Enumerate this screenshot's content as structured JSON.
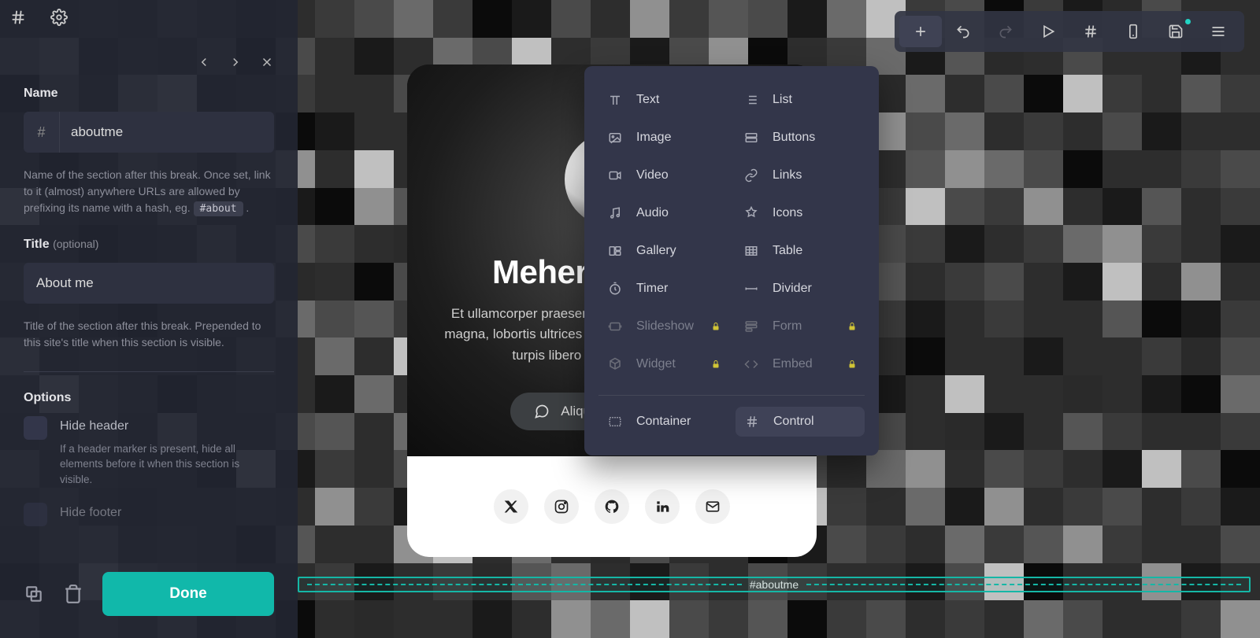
{
  "sidebar": {
    "name_label": "Name",
    "name_value": "aboutme",
    "name_help_pre": "Name of the section after this break. Once set, link to it (almost) anywhere URLs are allowed by prefixing its name with a hash, eg. ",
    "name_help_code": "#about",
    "title_label": "Title",
    "title_suffix": "(optional)",
    "title_value": "About me",
    "title_help": "Title of the section after this break. Prepended to this site's title when this section is visible.",
    "options_label": "Options",
    "opt_hide_header": "Hide header",
    "opt_hide_header_help": "If a header marker is present, hide all elements before it when this section is visible.",
    "opt_hide_footer": "Hide footer",
    "done": "Done"
  },
  "toolbar": {
    "add": "Add",
    "undo": "Undo",
    "redo": "Redo",
    "play": "Preview",
    "hash": "Sections",
    "mobile": "Mobile",
    "save": "Save",
    "menu": "Menu"
  },
  "dropdown": {
    "col1": [
      {
        "icon": "text",
        "label": "Text",
        "locked": false
      },
      {
        "icon": "image",
        "label": "Image",
        "locked": false
      },
      {
        "icon": "video",
        "label": "Video",
        "locked": false
      },
      {
        "icon": "audio",
        "label": "Audio",
        "locked": false
      },
      {
        "icon": "gallery",
        "label": "Gallery",
        "locked": false
      },
      {
        "icon": "timer",
        "label": "Timer",
        "locked": false
      },
      {
        "icon": "slideshow",
        "label": "Slideshow",
        "locked": true
      },
      {
        "icon": "widget",
        "label": "Widget",
        "locked": true
      }
    ],
    "col2": [
      {
        "icon": "list",
        "label": "List",
        "locked": false
      },
      {
        "icon": "buttons",
        "label": "Buttons",
        "locked": false
      },
      {
        "icon": "links",
        "label": "Links",
        "locked": false
      },
      {
        "icon": "icons",
        "label": "Icons",
        "locked": false
      },
      {
        "icon": "table",
        "label": "Table",
        "locked": false
      },
      {
        "icon": "divider",
        "label": "Divider",
        "locked": false
      },
      {
        "icon": "form",
        "label": "Form",
        "locked": true
      },
      {
        "icon": "embed",
        "label": "Embed",
        "locked": true
      }
    ],
    "container": "Container",
    "control": "Control"
  },
  "card": {
    "title": "Meherab Hasan",
    "desc": "Et ullamcorper praesent aliquam iaculis commodo nec magna, lobortis ultrices tincidunt arcu in cursus dui lacus turpis libero porttitor amet mauris.",
    "cta": "Aliquam sed mi sociis"
  },
  "ruler_label": "#aboutme"
}
